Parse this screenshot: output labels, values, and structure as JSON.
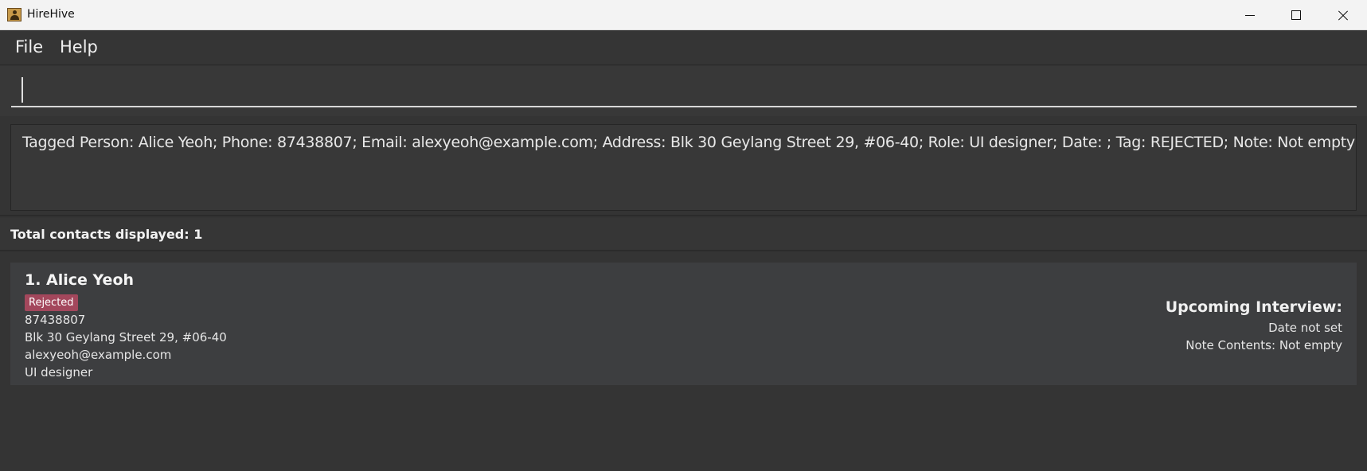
{
  "window": {
    "title": "HireHive"
  },
  "menu": {
    "items": [
      "File",
      "Help"
    ]
  },
  "command": {
    "value": ""
  },
  "result": {
    "text": "Tagged Person: Alice Yeoh; Phone: 87438807; Email: alexyeoh@example.com; Address: Blk 30 Geylang Street 29, #06-40; Role: UI designer; Date: ; Tag: REJECTED; Note: Not empty"
  },
  "list": {
    "count_label": "Total contacts displayed: 1"
  },
  "contacts": [
    {
      "name": "1. Alice Yeoh",
      "tag": "Rejected",
      "tag_color": "#a3475c",
      "phone": "87438807",
      "address": "Blk 30 Geylang Street 29, #06-40",
      "email": "alexyeoh@example.com",
      "role": "UI designer",
      "interview_title": "Upcoming Interview:",
      "interview_date": "Date not set",
      "note": "Note Contents: Not empty"
    }
  ]
}
